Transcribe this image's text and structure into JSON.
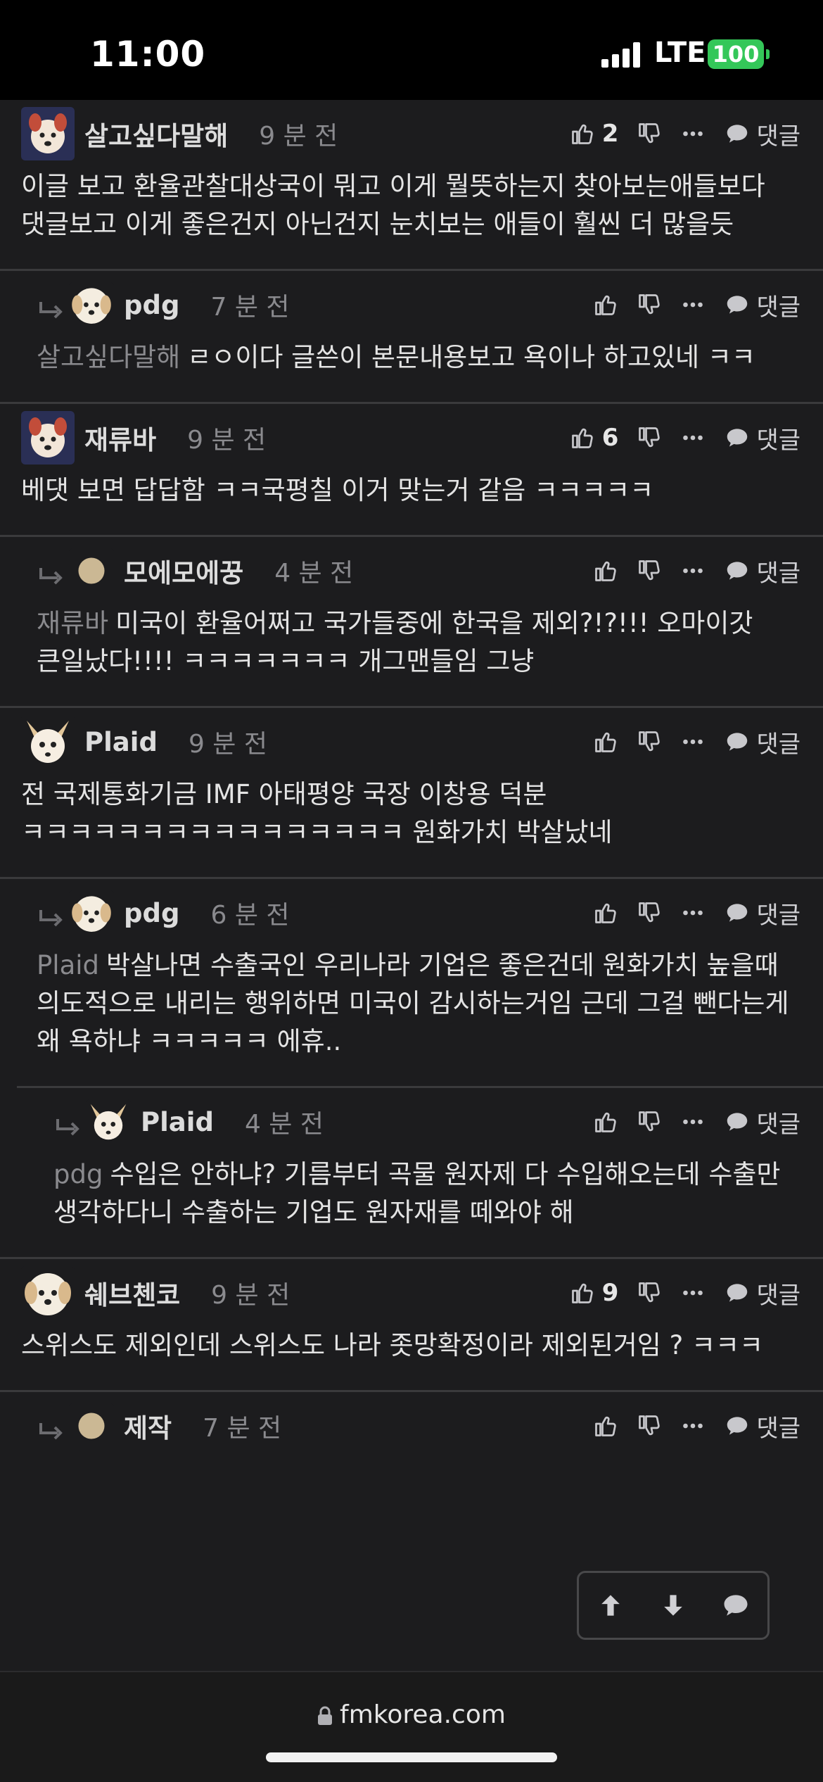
{
  "status_bar": {
    "time": "11:00",
    "network": "LTE",
    "battery": "100"
  },
  "comments": [
    {
      "author": "살고싶다말해",
      "time": "9 분 전",
      "likes": "2",
      "mention": "",
      "text": "이글 보고 환율관찰대상국이 뭐고 이게 뭘뜻하는지 찾아보는애들보다 댓글보고 이게 좋은건지 아닌건지 눈치보는 애들이 훨씬 더 많을듯",
      "reply_label": "댓글"
    },
    {
      "author": "pdg",
      "time": "7 분 전",
      "likes": "",
      "mention": "살고싶다말해",
      "text": "ㄹㅇ이다 글쓴이 본문내용보고 욕이나 하고있네 ㅋㅋ",
      "reply_label": "댓글"
    },
    {
      "author": "재류바",
      "time": "9 분 전",
      "likes": "6",
      "mention": "",
      "text": "베댓 보면 답답함 ㅋㅋ국평칠 이거 맞는거 같음 ㅋㅋㅋㅋㅋ",
      "reply_label": "댓글"
    },
    {
      "author": "모에모에꿍",
      "time": "4 분 전",
      "likes": "",
      "mention": "재류바",
      "text": "미국이 환율어쩌고 국가들중에 한국을 제외?!?!!! 오마이갓 큰일났다!!!! ㅋㅋㅋㅋㅋㅋㅋ 개그맨들임 그냥",
      "reply_label": "댓글"
    },
    {
      "author": "Plaid",
      "time": "9 분 전",
      "likes": "",
      "mention": "",
      "text": "전 국제통화기금 IMF 아태평양 국장 이창용 덕분 ㅋㅋㅋㅋㅋㅋㅋㅋㅋㅋㅋㅋㅋㅋㅋㅋ 원화가치 박살났네",
      "reply_label": "댓글"
    },
    {
      "author": "pdg",
      "time": "6 분 전",
      "likes": "",
      "mention": "Plaid",
      "text": "박살나면 수출국인 우리나라 기업은 좋은건데 원화가치 높을때 의도적으로 내리는 행위하면 미국이 감시하는거임 근데 그걸 뺀다는게 왜 욕하냐 ㅋㅋㅋㅋㅋ 에휴..",
      "reply_label": "댓글"
    },
    {
      "author": "Plaid",
      "time": "4 분 전",
      "likes": "",
      "mention": "pdg",
      "text": "수입은 안하냐? 기름부터 곡물 원자제 다 수입해오는데 수출만 생각하다니 수출하는 기업도 원자재를 떼와야 해",
      "reply_label": "댓글"
    },
    {
      "author": "쉐브첸코",
      "time": "9 분 전",
      "likes": "9",
      "mention": "",
      "text": "스위스도 제외인데 스위스도 나라 좃망확정이라 제외된거임 ? ㅋㅋㅋ",
      "reply_label": "댓글"
    },
    {
      "author": "제작",
      "time": "7 분 전",
      "likes": "",
      "mention": "",
      "text": "",
      "reply_label": "댓글"
    }
  ],
  "browser": {
    "url": "fmkorea.com"
  },
  "colors": {
    "background": "#1c1c1e",
    "divider": "#3a3a3c",
    "battery": "#34c759",
    "muted": "#8a8a8e"
  }
}
